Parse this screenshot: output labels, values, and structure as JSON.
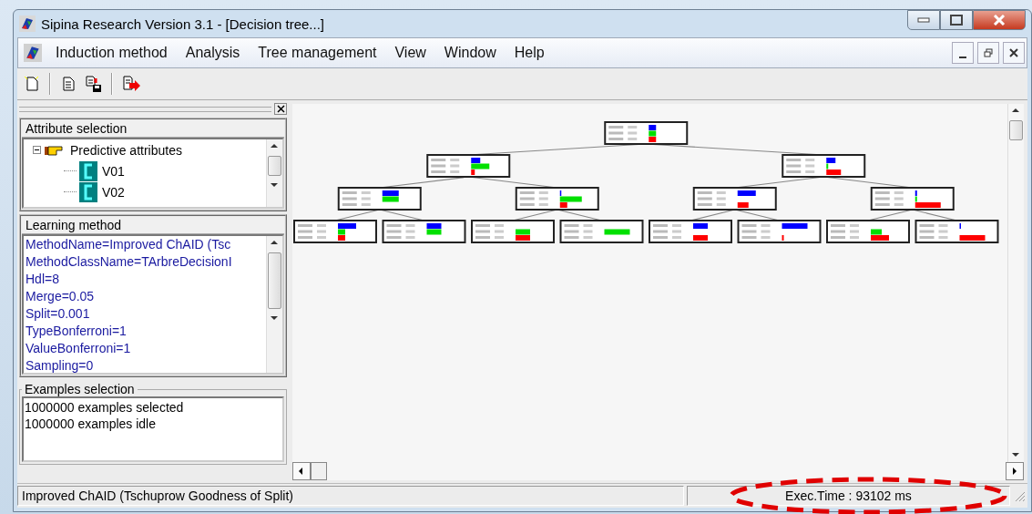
{
  "window": {
    "title": "Sipina Research Version 3.1 - [Decision tree...]"
  },
  "menu": [
    "Induction method",
    "Analysis",
    "Tree management",
    "View",
    "Window",
    "Help"
  ],
  "attribute_selection": {
    "title": "Attribute selection",
    "root": {
      "label": "Predictive attributes",
      "expanded": true,
      "children": [
        {
          "label": "V01"
        },
        {
          "label": "V02"
        }
      ]
    }
  },
  "learning_method": {
    "title": "Learning method",
    "lines": [
      "MethodName=Improved ChAID (Tsc",
      "MethodClassName=TArbreDecisionI",
      "Hdl=8",
      "Merge=0.05",
      "Split=0.001",
      "TypeBonferroni=1",
      "ValueBonferroni=1",
      "Sampling=0"
    ]
  },
  "examples_selection": {
    "title": "Examples selection",
    "lines": [
      "1000000 examples selected",
      "1000000 examples idle"
    ]
  },
  "status_bar": {
    "method": "Improved ChAID (Tschuprow Goodness of Split)",
    "exec_time": "Exec.Time : 93102 ms"
  }
}
